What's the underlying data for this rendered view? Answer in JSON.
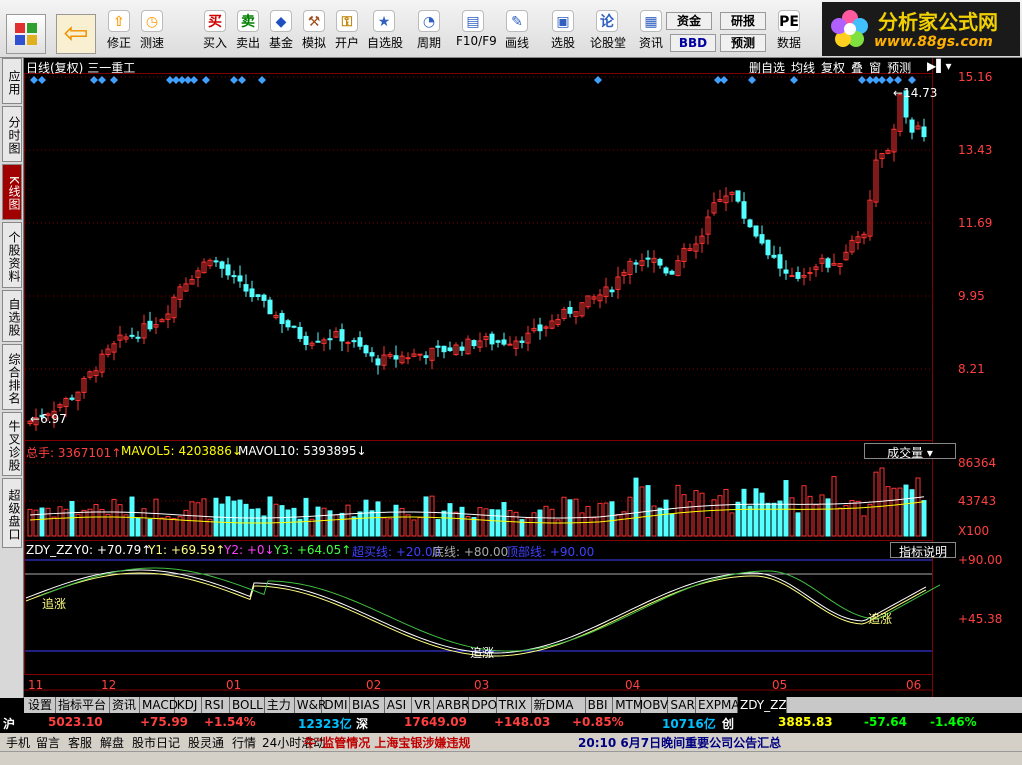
{
  "toolbar": {
    "buttons": [
      {
        "label": "修正",
        "icon": "up-arrow-icon",
        "color": "#ff9900",
        "glyph": "⇧"
      },
      {
        "label": "测速",
        "icon": "stopwatch-icon",
        "color": "#ff9900",
        "glyph": "◷"
      },
      {
        "label": "买入",
        "icon": "buy-icon",
        "color": "#d00000",
        "glyph": "买"
      },
      {
        "label": "卖出",
        "icon": "sell-icon",
        "color": "#008000",
        "glyph": "卖"
      },
      {
        "label": "基金",
        "icon": "fund-icon",
        "color": "#2050c0",
        "glyph": "◆"
      },
      {
        "label": "模拟",
        "icon": "hammer-icon",
        "color": "#a05020",
        "glyph": "⚒"
      },
      {
        "label": "开户",
        "icon": "lock-icon",
        "color": "#c08000",
        "glyph": "⚿"
      },
      {
        "label": "自选股",
        "icon": "star-icon",
        "color": "#3060c0",
        "glyph": "★"
      },
      {
        "label": "周期",
        "icon": "clock-icon",
        "color": "#3060c0",
        "glyph": "◔"
      },
      {
        "label": "F10/F9",
        "icon": "f10-icon",
        "color": "#3060c0",
        "glyph": "▤"
      },
      {
        "label": "画线",
        "icon": "pen-icon",
        "color": "#3060c0",
        "glyph": "✎"
      },
      {
        "label": "选股",
        "icon": "monitor-icon",
        "color": "#3060c0",
        "glyph": "▣"
      },
      {
        "label": "论股堂",
        "icon": "forum-icon",
        "color": "#3060c0",
        "glyph": "论"
      },
      {
        "label": "资讯",
        "icon": "news-icon",
        "color": "#3060c0",
        "glyph": "▦"
      },
      {
        "label": "资金",
        "icon": "capital-icon",
        "color": "#000",
        "glyph": "资金"
      },
      {
        "label": "研报",
        "icon": "report-icon",
        "color": "#000",
        "glyph": "研报"
      },
      {
        "label": "BBD",
        "icon": "bbd-icon",
        "color": "#0000a0",
        "glyph": "BBD"
      },
      {
        "label": "预测",
        "icon": "forecast-icon",
        "color": "#000",
        "glyph": "预测"
      },
      {
        "label": "数据",
        "icon": "pe-icon",
        "color": "#000",
        "glyph": "PE"
      }
    ]
  },
  "logo": {
    "title": "分析家公式网",
    "url": "www.88gs.com"
  },
  "side_tabs": [
    "应用",
    "分时图",
    "K线图",
    "个股资料",
    "自选股",
    "综合排名",
    "牛叉诊股",
    "超级盘口"
  ],
  "side_active": 2,
  "main_panel": {
    "title": "日线(复权)",
    "stock": "三一重工",
    "header_buttons": [
      "删自选",
      "均线",
      "复权",
      "叠",
      "窗",
      "预测"
    ],
    "high_label": "14.73",
    "low_label": "6.97",
    "y_ticks": [
      "15.16",
      "13.43",
      "11.69",
      "9.95",
      "8.21"
    ]
  },
  "volume_panel": {
    "total_label": "总手:",
    "total_value": "3367101",
    "mavol5_label": "MAVOL5:",
    "mavol5_value": "4203886",
    "mavol10_label": "MAVOL10:",
    "mavol10_value": "5393895",
    "dropdown": "成交量",
    "y_ticks": [
      "86364",
      "43743",
      "X100"
    ]
  },
  "indicator_panel": {
    "name": "ZDY_ZZ",
    "y0": "Y0: +70.79",
    "y1": "Y1: +69.59",
    "y2": "Y2: +0",
    "y3": "Y3: +64.05",
    "chaomai": "超买线: +20.00",
    "dixian": "底线: +80.00",
    "dingbu": "顶部线: +90.00",
    "help_button": "指标说明",
    "y_ticks": [
      "+90.00",
      "+45.38"
    ],
    "annotations": [
      "追涨",
      "追涨",
      "追涨"
    ]
  },
  "x_axis": [
    "11",
    "12",
    "01",
    "02",
    "03",
    "04",
    "05",
    "06"
  ],
  "bottom_tabs": [
    "设置",
    "指标平台",
    "资讯",
    "MACD",
    "KDJ",
    "RSI",
    "BOLL",
    "主力",
    "W&R",
    "DMI",
    "BIAS",
    "ASI",
    "VR",
    "ARBR",
    "DPO",
    "TRIX",
    "新DMA",
    "BBI",
    "MTM",
    "OBV",
    "SAR",
    "EXPMA",
    "ZDY_ZZ"
  ],
  "bottom_active": 22,
  "ticker": {
    "sh_label": "沪",
    "sh_value": "5023.10",
    "sh_change": "+75.99",
    "sh_pct": "+1.54%",
    "sh_amount": "12323亿",
    "sz_label": "深",
    "sz_value": "17649.09",
    "sz_change": "+148.03",
    "sz_pct": "+0.85%",
    "sz_amount": "10716亿",
    "cy_label": "创",
    "cy_value": "3885.83",
    "cy_change": "-57.64",
    "cy_pct": "-1.46%"
  },
  "status": {
    "items": [
      "手机",
      "留言",
      "客服",
      "解盘",
      "股市日记",
      "股灵通",
      "行情",
      "24小时滚动"
    ],
    "news1": "牛\"监管情况 上海宝银涉嫌违规",
    "news2": "20:10 6月7日晚间重要公司公告汇总"
  },
  "colors": {
    "up": "#ff3232",
    "down": "#54ffff",
    "ma5": "#ffffff",
    "ma10": "#ffff00",
    "grid": "#800000",
    "line_y1": "#ffff80",
    "line_y3": "#40c040"
  }
}
